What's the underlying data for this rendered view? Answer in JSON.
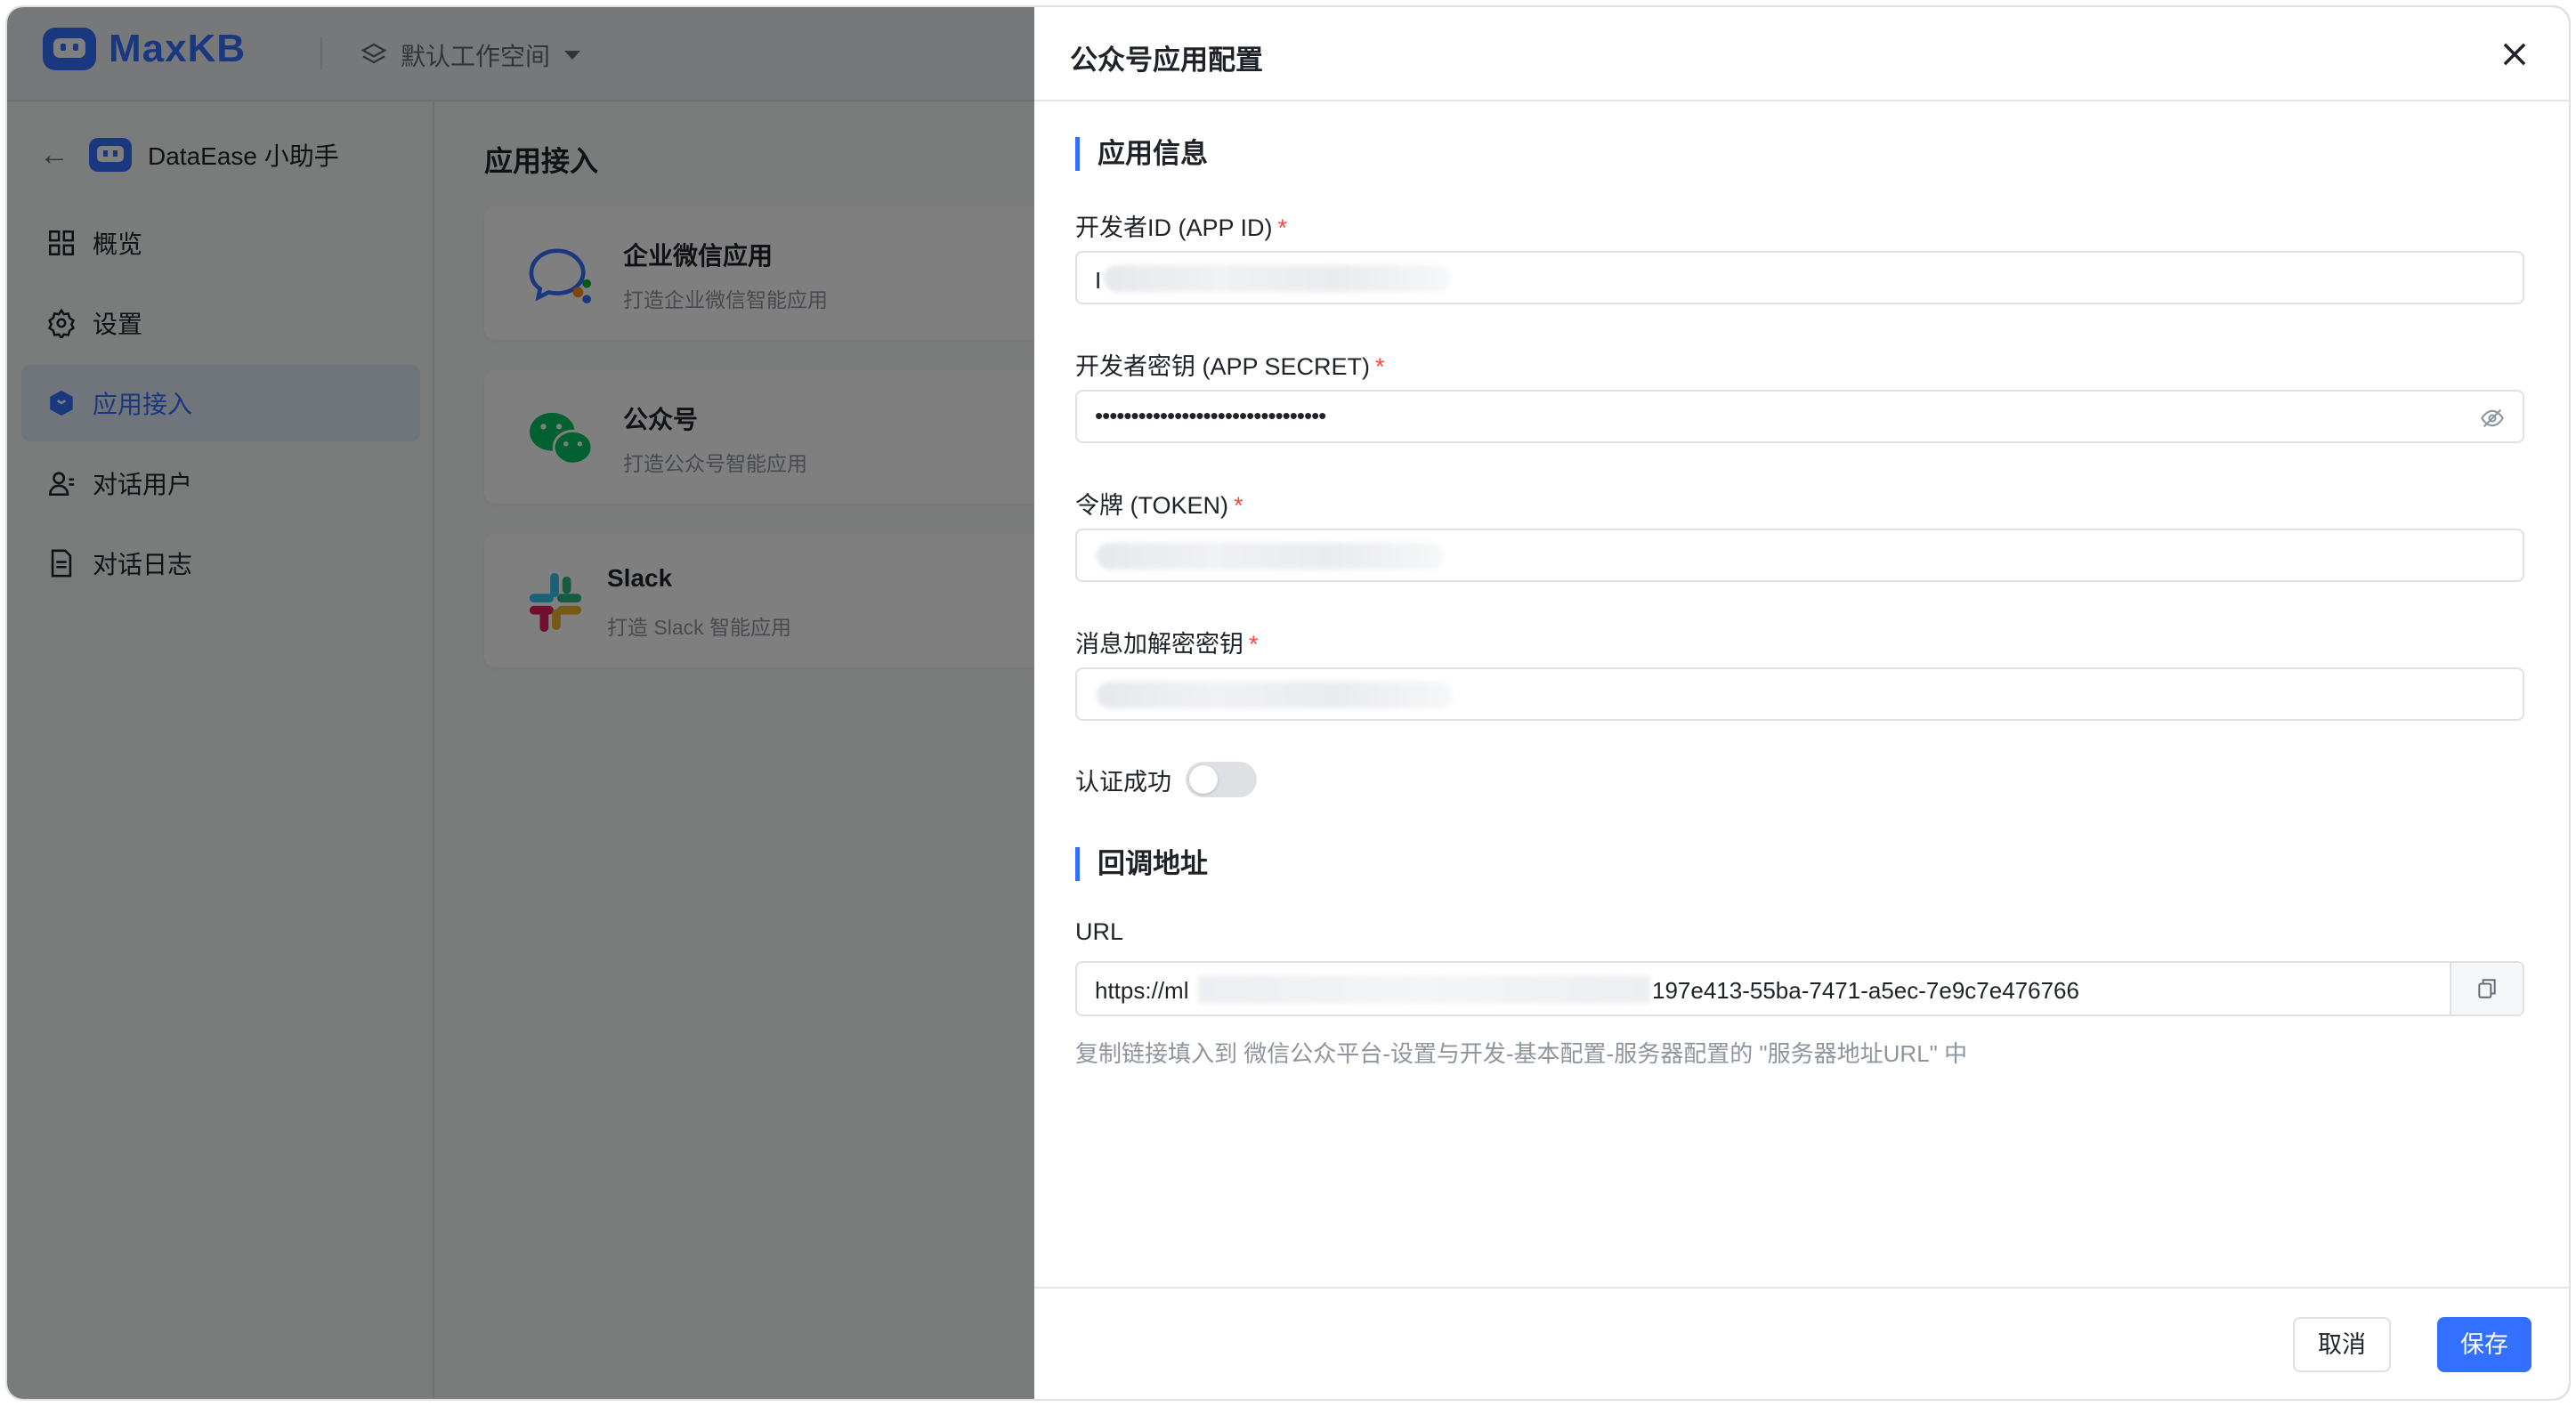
{
  "header": {
    "logo_text": "MaxKB",
    "workspace": "默认工作空间"
  },
  "sidebar": {
    "app_name": "DataEase 小助手",
    "items": [
      {
        "label": "概览",
        "icon": "grid-icon"
      },
      {
        "label": "设置",
        "icon": "gear-icon"
      },
      {
        "label": "应用接入",
        "icon": "cube-icon",
        "active": true
      },
      {
        "label": "对话用户",
        "icon": "user-icon"
      },
      {
        "label": "对话日志",
        "icon": "document-icon"
      }
    ]
  },
  "main": {
    "title": "应用接入",
    "cards": [
      {
        "title": "企业微信应用",
        "desc": "打造企业微信智能应用",
        "icon": "wecom-icon"
      },
      {
        "title": "公众号",
        "desc": "打造公众号智能应用",
        "icon": "wechat-icon"
      },
      {
        "title": "Slack",
        "desc": "打造 Slack 智能应用",
        "icon": "slack-icon"
      }
    ]
  },
  "drawer": {
    "title": "公众号应用配置",
    "section_app_info": "应用信息",
    "fields": {
      "app_id": {
        "label": "开发者ID (APP ID)",
        "value": "I"
      },
      "app_secret": {
        "label": "开发者密钥 (APP SECRET)",
        "value": "••••••••••••••••••••••••••••••••"
      },
      "token": {
        "label": "令牌 (TOKEN)"
      },
      "aes_key": {
        "label": "消息加解密密钥"
      }
    },
    "required_mark": "*",
    "auth_label": "认证成功",
    "auth_on": false,
    "section_callback": "回调地址",
    "url_label": "URL",
    "url_prefix": "https://ml",
    "url_suffix": "197e413-55ba-7471-a5ec-7e9c7e476766",
    "hint": "复制链接填入到 微信公众平台-设置与开发-基本配置-服务器配置的 \"服务器地址URL\" 中",
    "cancel": "取消",
    "save": "保存"
  },
  "colors": {
    "primary": "#3370ff",
    "required": "#f54a45",
    "overlay": "rgba(0,0,0,0.5)"
  }
}
